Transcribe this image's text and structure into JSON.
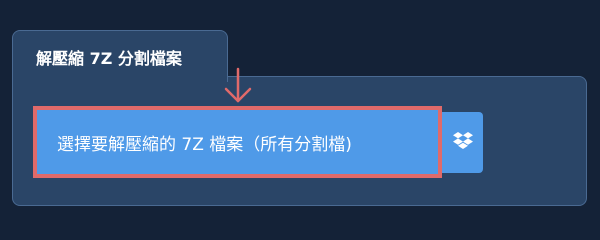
{
  "tab": {
    "title": "解壓縮 7Z 分割檔案"
  },
  "upload": {
    "select_label": "選擇要解壓縮的 7Z 檔案（所有分割檔)",
    "dropbox_icon": "dropbox-icon"
  },
  "colors": {
    "background": "#142237",
    "panel": "#2a4567",
    "button": "#4f9ae8",
    "highlight": "#e06a6a"
  }
}
